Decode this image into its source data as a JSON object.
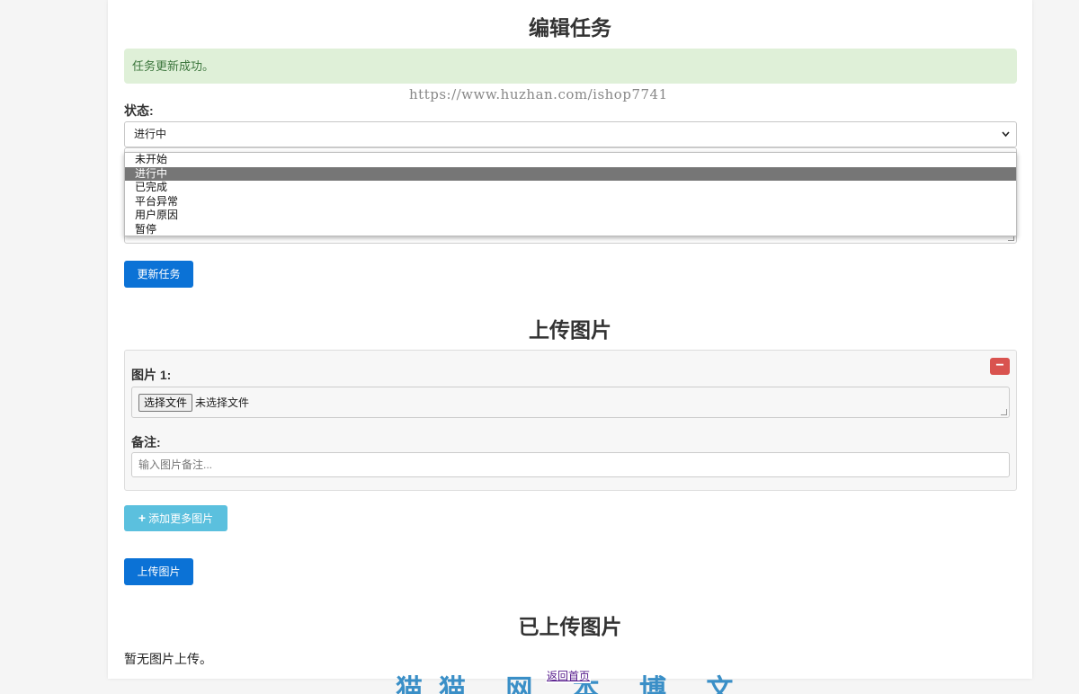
{
  "titles": {
    "edit_task": "编辑任务",
    "upload_images": "上传图片",
    "uploaded_images": "已上传图片"
  },
  "alert": {
    "message": "任务更新成功。",
    "color": "#dff0d8"
  },
  "watermark": "https://www.huzhan.com/ishop7741",
  "status": {
    "label": "状态:",
    "selected": "进行中",
    "options": [
      "未开始",
      "进行中",
      "已完成",
      "平台异常",
      "用户原因",
      "暂停"
    ],
    "selected_index": 1
  },
  "buttons": {
    "update_task": "更新任务",
    "add_more_images": "添加更多图片",
    "upload_images": "上传图片",
    "remove": "−",
    "primary_color": "#0b72d6",
    "info_color": "#5bc0de",
    "danger_color": "#d9534f"
  },
  "image_entry": {
    "label": "图片 1:",
    "file_button": "选择文件",
    "file_status": "未选择文件",
    "note_label": "备注:",
    "note_placeholder": "输入图片备注..."
  },
  "uploaded": {
    "empty_message": "暂无图片上传。"
  },
  "footer": {
    "back_link": "返回首页",
    "banner_text": "猫猫 网 本 博 文 最 美 汇"
  },
  "icons": {
    "plus": "plus-icon",
    "chevron": "chevron-down-icon",
    "minus": "minus-icon"
  }
}
